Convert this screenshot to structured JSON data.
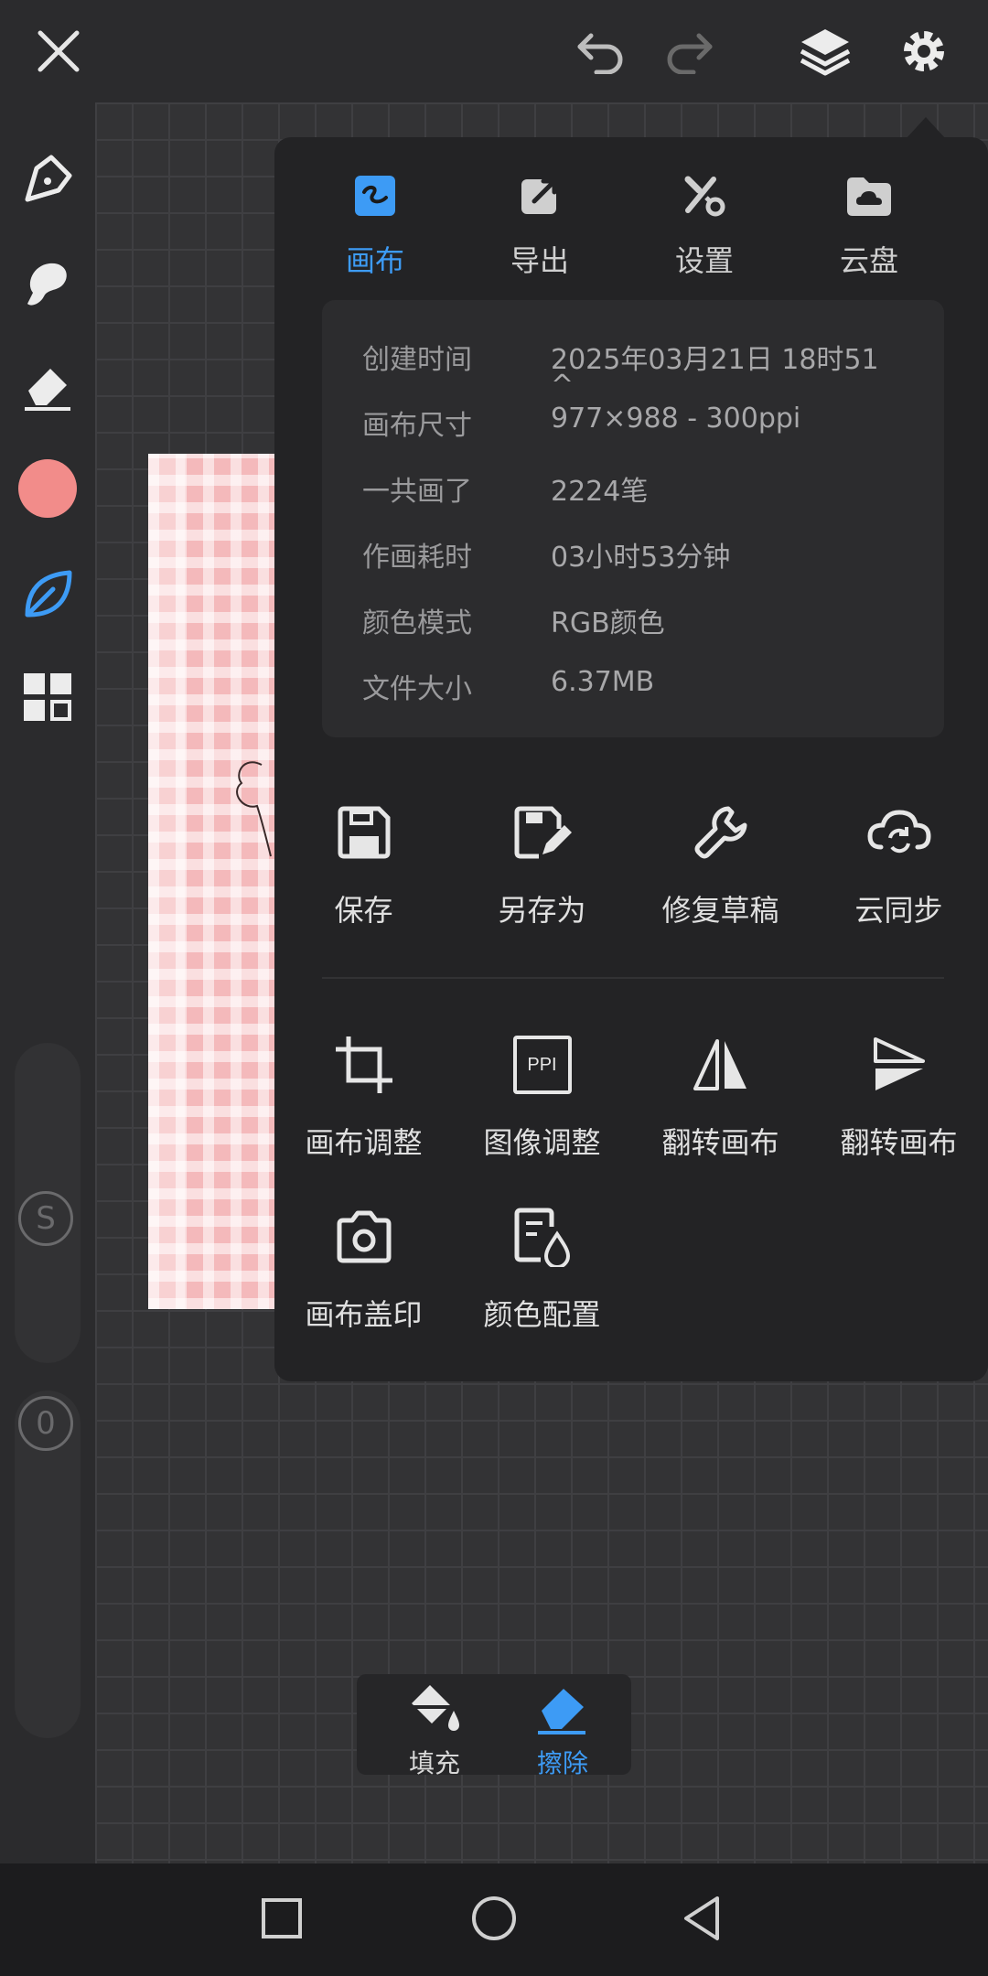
{
  "colors": {
    "accent": "#3d9bf5",
    "brush_color": "#f28c8a",
    "panel_bg": "#232325",
    "text_primary": "#e0e0e0",
    "text_muted": "#9a9a9c"
  },
  "toolbar": {
    "icons": [
      "close-icon",
      "undo-icon",
      "redo-icon",
      "layers-icon",
      "gear-icon"
    ]
  },
  "left_tools": [
    "pen-icon",
    "smudge-icon",
    "eraser-icon",
    "color-swatch",
    "leaf-icon",
    "grid-icon"
  ],
  "sliders": {
    "size_label": "S",
    "opacity_label": "0"
  },
  "popup": {
    "tabs": [
      {
        "label": "画布",
        "icon": "canvas-icon",
        "active": true
      },
      {
        "label": "导出",
        "icon": "export-icon",
        "active": false
      },
      {
        "label": "设置",
        "icon": "settings-tools-icon",
        "active": false
      },
      {
        "label": "云盘",
        "icon": "cloud-drive-icon",
        "active": false
      }
    ],
    "info": [
      {
        "key": "创建时间",
        "value": "2025年03月21日 18时51",
        "value2": "^"
      },
      {
        "key": "画布尺寸",
        "value": "977×988 - 300ppi"
      },
      {
        "key": "一共画了",
        "value": "2224笔"
      },
      {
        "key": "作画耗时",
        "value": "03小时53分钟"
      },
      {
        "key": "颜色模式",
        "value": "RGB颜色"
      },
      {
        "key": "文件大小",
        "value": "6.37MB"
      }
    ],
    "actions_row1": [
      {
        "label": "保存",
        "icon": "save-icon"
      },
      {
        "label": "另存为",
        "icon": "save-as-icon"
      },
      {
        "label": "修复草稿",
        "icon": "wrench-icon"
      },
      {
        "label": "云同步",
        "icon": "cloud-sync-icon"
      }
    ],
    "actions_row2": [
      {
        "label": "画布调整",
        "icon": "crop-icon"
      },
      {
        "label": "图像调整",
        "icon": "ppi-icon",
        "badge": "PPI"
      },
      {
        "label": "翻转画布",
        "icon": "flip-horizontal-icon"
      },
      {
        "label": "翻转画布",
        "icon": "flip-vertical-icon"
      }
    ],
    "actions_row3": [
      {
        "label": "画布盖印",
        "icon": "camera-icon"
      },
      {
        "label": "颜色配置",
        "icon": "color-profile-icon"
      }
    ]
  },
  "bottom_tools": [
    {
      "label": "填充",
      "icon": "fill-bucket-icon",
      "active": false
    },
    {
      "label": "擦除",
      "icon": "eraser-icon",
      "active": true
    }
  ],
  "navbar": [
    "recent-apps-icon",
    "home-icon",
    "back-icon"
  ]
}
